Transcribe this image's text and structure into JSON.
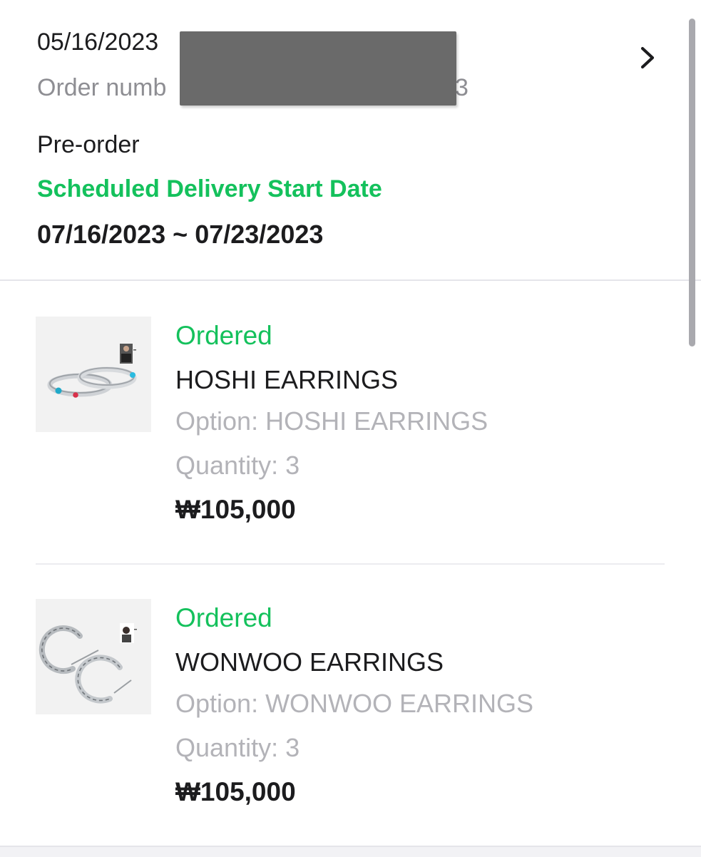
{
  "order": {
    "date_partial": "05/16/2023",
    "number_prefix": "Order numb",
    "number_suffix": "3",
    "details_icon": "chevron-right-icon",
    "type": "Pre-order",
    "delivery_label": "Scheduled Delivery Start Date",
    "delivery_range": "07/16/2023 ~ 07/23/2023"
  },
  "items": [
    {
      "status": "Ordered",
      "name": "HOSHI EARRINGS",
      "option": "Option: HOSHI EARRINGS",
      "quantity": "Quantity: 3",
      "price": "₩105,000"
    },
    {
      "status": "Ordered",
      "name": "WONWOO EARRINGS",
      "option": "Option: WONWOO EARRINGS",
      "quantity": "Quantity: 3",
      "price": "₩105,000"
    }
  ],
  "colors": {
    "accent_green": "#14c15c",
    "text_primary": "#1c1c1e",
    "text_secondary": "#8e8e93",
    "text_muted": "#b3b3b8",
    "redaction": "#6a6a6a"
  }
}
